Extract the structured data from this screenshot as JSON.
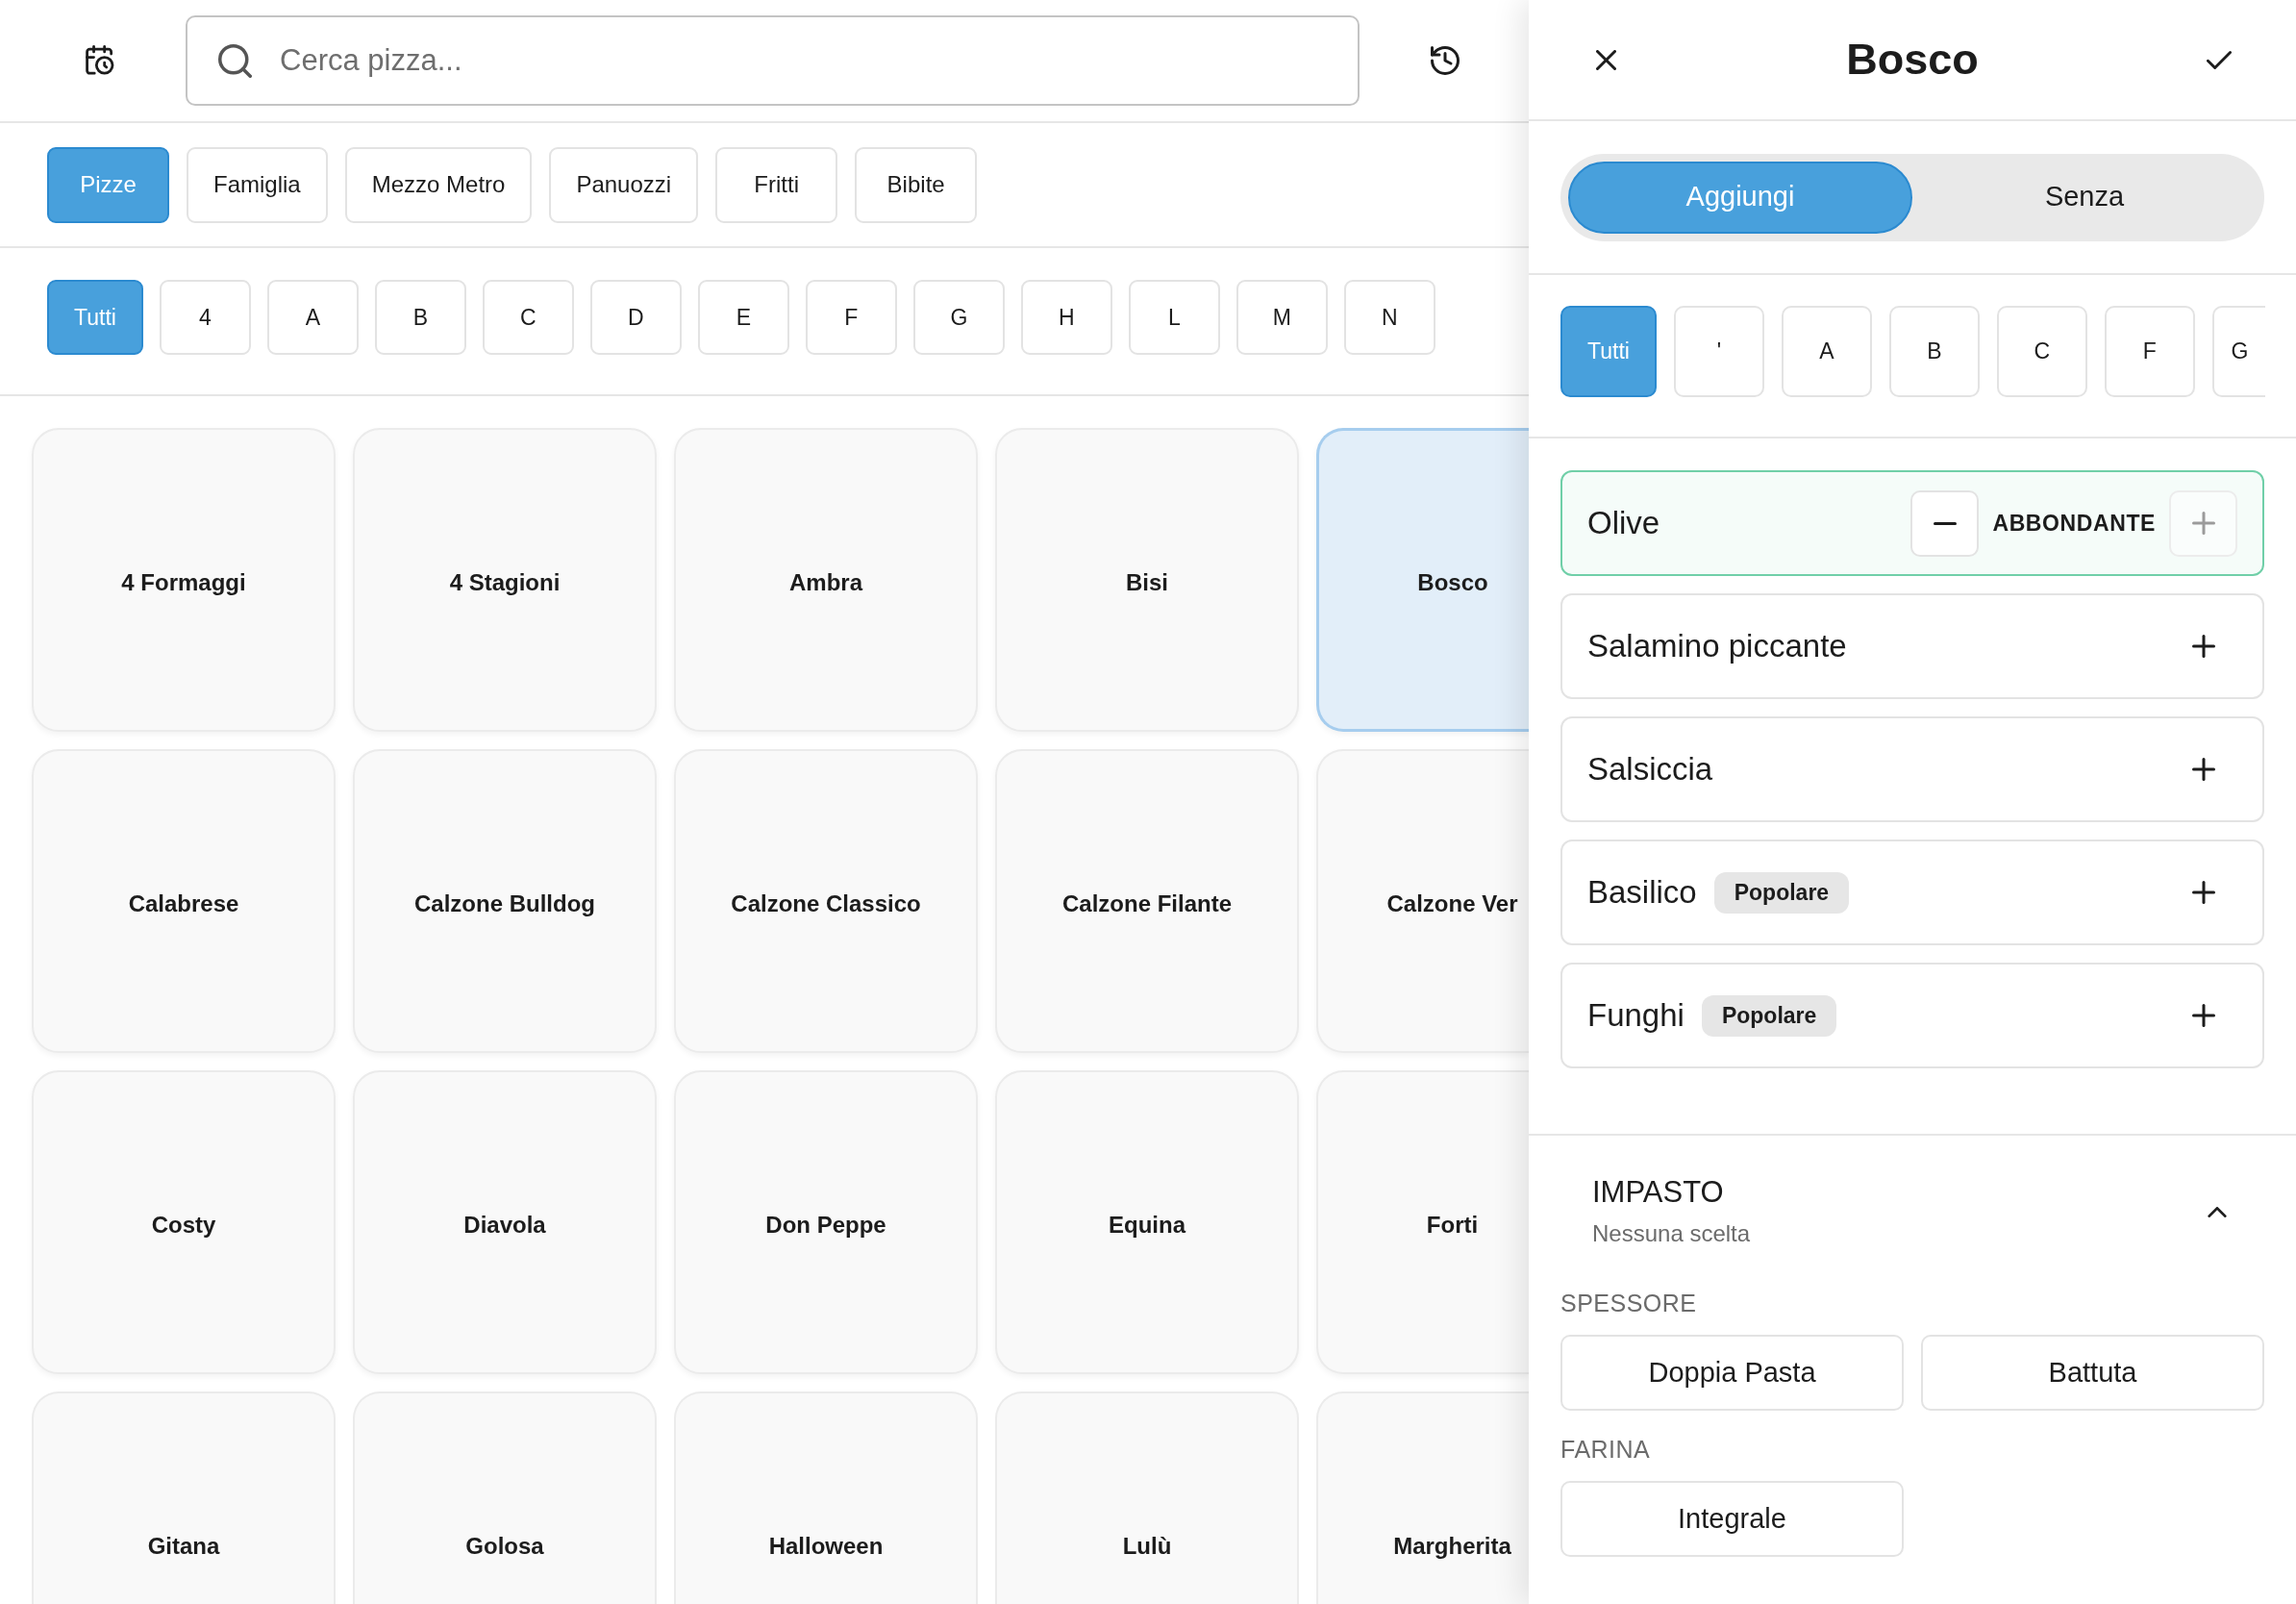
{
  "toolbar": {
    "search": {
      "placeholder": "Cerca pizza..."
    }
  },
  "categories": [
    {
      "label": "Pizze",
      "selected": true
    },
    {
      "label": "Famiglia",
      "selected": false
    },
    {
      "label": "Mezzo Metro",
      "selected": false
    },
    {
      "label": "Panuozzi",
      "selected": false
    },
    {
      "label": "Fritti",
      "selected": false
    },
    {
      "label": "Bibite",
      "selected": false
    }
  ],
  "letters": [
    {
      "label": "Tutti",
      "selected": true
    },
    {
      "label": "4",
      "selected": false
    },
    {
      "label": "A",
      "selected": false
    },
    {
      "label": "B",
      "selected": false
    },
    {
      "label": "C",
      "selected": false
    },
    {
      "label": "D",
      "selected": false
    },
    {
      "label": "E",
      "selected": false
    },
    {
      "label": "F",
      "selected": false
    },
    {
      "label": "G",
      "selected": false
    },
    {
      "label": "H",
      "selected": false
    },
    {
      "label": "L",
      "selected": false
    },
    {
      "label": "M",
      "selected": false
    },
    {
      "label": "N",
      "selected": false
    }
  ],
  "pizzas": [
    {
      "name": "4 Formaggi",
      "selected": false
    },
    {
      "name": "4 Stagioni",
      "selected": false
    },
    {
      "name": "Ambra",
      "selected": false
    },
    {
      "name": "Bisi",
      "selected": false
    },
    {
      "name": "Bosco",
      "selected": true
    },
    {
      "name": "Calabrese",
      "selected": false
    },
    {
      "name": "Calzone Bulldog",
      "selected": false
    },
    {
      "name": "Calzone Classico",
      "selected": false
    },
    {
      "name": "Calzone Filante",
      "selected": false
    },
    {
      "name": "Calzone Ver",
      "selected": false
    },
    {
      "name": "Costy",
      "selected": false
    },
    {
      "name": "Diavola",
      "selected": false
    },
    {
      "name": "Don Peppe",
      "selected": false
    },
    {
      "name": "Equina",
      "selected": false
    },
    {
      "name": "Forti",
      "selected": false
    },
    {
      "name": "Gitana",
      "selected": false
    },
    {
      "name": "Golosa",
      "selected": false
    },
    {
      "name": "Halloween",
      "selected": false
    },
    {
      "name": "Lulù",
      "selected": false
    },
    {
      "name": "Margherita",
      "selected": false
    }
  ],
  "panel": {
    "title": "Bosco",
    "modes": [
      {
        "label": "Aggiungi",
        "selected": true
      },
      {
        "label": "Senza",
        "selected": false
      }
    ],
    "letters": [
      {
        "label": "Tutti",
        "selected": true
      },
      {
        "label": "'",
        "selected": false
      },
      {
        "label": "A",
        "selected": false
      },
      {
        "label": "B",
        "selected": false
      },
      {
        "label": "C",
        "selected": false
      },
      {
        "label": "F",
        "selected": false
      },
      {
        "label": "G",
        "selected": false
      }
    ],
    "ingredients": [
      {
        "name": "Olive",
        "selected": true,
        "quantity": "ABBONDANTE",
        "increase_disabled": true
      },
      {
        "name": "Salamino piccante",
        "selected": false
      },
      {
        "name": "Salsiccia",
        "selected": false
      },
      {
        "name": "Basilico",
        "selected": false,
        "badge": "Popolare"
      },
      {
        "name": "Funghi",
        "selected": false,
        "badge": "Popolare"
      }
    ],
    "dough": {
      "title": "IMPASTO",
      "summary": "Nessuna scelta",
      "expanded": true,
      "groups": [
        {
          "label": "SPESSORE",
          "options": [
            {
              "label": "Doppia Pasta",
              "selected": false
            },
            {
              "label": "Battuta",
              "selected": false
            }
          ]
        },
        {
          "label": "FARINA",
          "options": [
            {
              "label": "Integrale",
              "selected": false
            }
          ]
        }
      ]
    }
  }
}
